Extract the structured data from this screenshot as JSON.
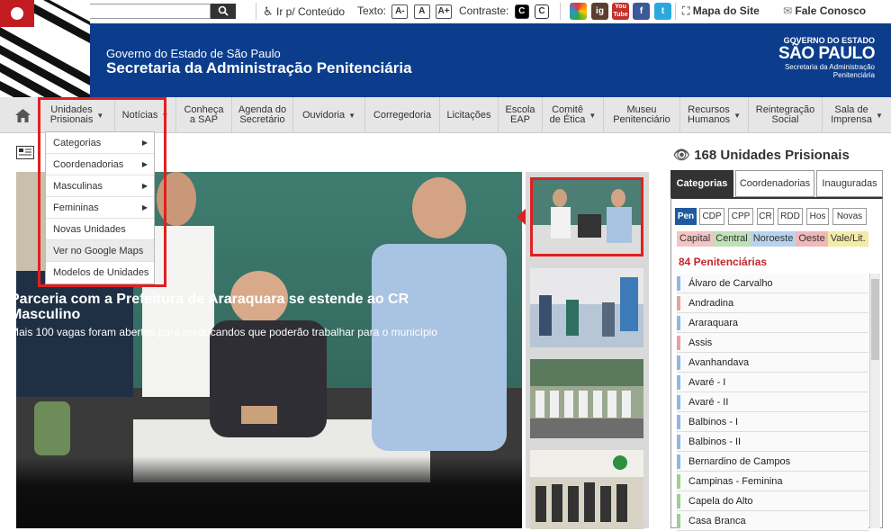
{
  "util": {
    "search_btn_icon": "search-icon",
    "skip_link": "Ir p/ Conteúdo",
    "text_label": "Texto:",
    "text_buttons": [
      "A-",
      "A",
      "A+"
    ],
    "contrast_label": "Contraste:",
    "contrast_buttons": [
      "C",
      "C"
    ],
    "social": [
      "Y",
      "ig",
      "You Tube",
      "f",
      "t"
    ],
    "sitemap": "Mapa do Site",
    "contact": "Fale Conosco"
  },
  "header": {
    "gov_line": "Governo do Estado de São Paulo",
    "title": "Secretaria da Administração Penitenciária",
    "logo_top": "GOVERNO DO ESTADO",
    "logo_main": "SÃO PAULO",
    "logo_sub1": "Secretaria da Administração",
    "logo_sub2": "Penitenciária"
  },
  "nav": [
    {
      "label1": "Unidades",
      "label2": "Prisionais",
      "caret": true
    },
    {
      "label1": "Notícias",
      "label2": "",
      "caret": true
    },
    {
      "label1": "Conheça",
      "label2": "a SAP",
      "caret": false
    },
    {
      "label1": "Agenda do",
      "label2": "Secretário",
      "caret": false
    },
    {
      "label1": "Ouvidoria",
      "label2": "",
      "caret": true
    },
    {
      "label1": "Corregedoria",
      "label2": "",
      "caret": false
    },
    {
      "label1": "Licitações",
      "label2": "",
      "caret": false
    },
    {
      "label1": "Escola",
      "label2": "EAP",
      "caret": false
    },
    {
      "label1": "Comitê",
      "label2": "de Ética",
      "caret": true
    },
    {
      "label1": "Museu",
      "label2": "Penitenciário",
      "caret": false
    },
    {
      "label1": "Recursos",
      "label2": "Humanos",
      "caret": true
    },
    {
      "label1": "Reintegração",
      "label2": "Social",
      "caret": false
    },
    {
      "label1": "Sala de",
      "label2": "Imprensa",
      "caret": true
    }
  ],
  "dropdown": [
    {
      "label": "Categorias",
      "arrow": true
    },
    {
      "label": "Coordenadorias",
      "arrow": true
    },
    {
      "label": "Masculinas",
      "arrow": true
    },
    {
      "label": "Femininas",
      "arrow": true
    },
    {
      "label": "Novas Unidades",
      "arrow": false
    },
    {
      "label": "Ver no Google Maps",
      "arrow": false
    },
    {
      "label": "Modelos de Unidades",
      "arrow": false
    }
  ],
  "slider": {
    "title": "Parceria com a Prefeitura de Araraquara se estende ao CR Masculino",
    "subtitle": "Mais 100 vagas foram abertas para reeducandos que poderão trabalhar para o município"
  },
  "panel": {
    "title": "168 Unidades Prisionais",
    "tabs": [
      "Categorias",
      "Coordenadorias",
      "Inauguradas"
    ],
    "chips": [
      "Pen",
      "CDP",
      "CPP",
      "CR",
      "RDD",
      "Hos",
      "Novas"
    ],
    "regions": [
      {
        "label": "Capital",
        "color": "#f2c4c4"
      },
      {
        "label": "Central",
        "color": "#bfe0b8"
      },
      {
        "label": "Noroeste",
        "color": "#b9d3ee"
      },
      {
        "label": "Oeste",
        "color": "#f0b8b8"
      },
      {
        "label": "Vale/Lit.",
        "color": "#f3eba6"
      }
    ],
    "count": "84 Penitenciárias",
    "items": [
      {
        "label": "Álvaro de Carvalho",
        "color": "#8fb8e6"
      },
      {
        "label": "Andradina",
        "color": "#eaa0a0"
      },
      {
        "label": "Araraquara",
        "color": "#8fb8e6"
      },
      {
        "label": "Assis",
        "color": "#eaa0a0"
      },
      {
        "label": "Avanhandava",
        "color": "#8fb8e6"
      },
      {
        "label": "Avaré - I",
        "color": "#8fb8e6"
      },
      {
        "label": "Avaré - II",
        "color": "#8fb8e6"
      },
      {
        "label": "Balbinos - I",
        "color": "#8fb8e6"
      },
      {
        "label": "Balbinos - II",
        "color": "#8fb8e6"
      },
      {
        "label": "Bernardino de Campos",
        "color": "#8fb8e6"
      },
      {
        "label": "Campinas - Feminina",
        "color": "#9ccf90"
      },
      {
        "label": "Capela do Alto",
        "color": "#9ccf90"
      },
      {
        "label": "Casa Branca",
        "color": "#9ccf90"
      }
    ]
  }
}
